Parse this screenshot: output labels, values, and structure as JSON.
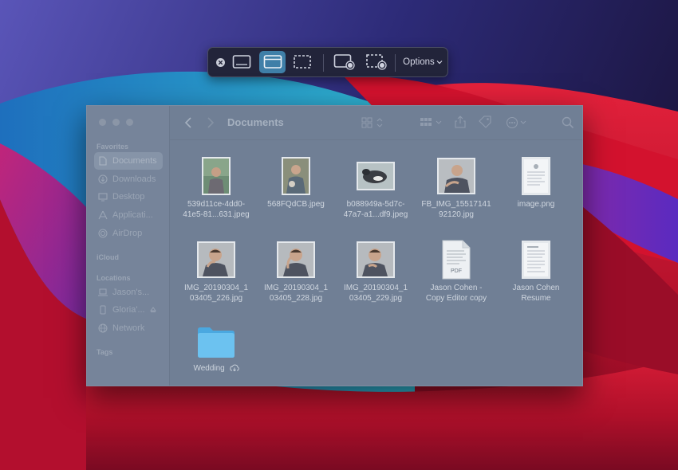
{
  "toolbar": {
    "close_icon": "close-icon",
    "modes": [
      "capture-entire-screen",
      "capture-selected-window",
      "capture-selected-portion",
      "record-entire-screen",
      "record-selected-portion"
    ],
    "options_label": "Options",
    "accent": "#3f7fa8"
  },
  "finder": {
    "title": "Documents",
    "sidebar": {
      "favorites_header": "Favorites",
      "favorites": [
        {
          "label": "Documents",
          "icon": "document-icon",
          "selected": true
        },
        {
          "label": "Downloads",
          "icon": "download-icon"
        },
        {
          "label": "Desktop",
          "icon": "desktop-icon"
        },
        {
          "label": "Applicati...",
          "icon": "applications-icon"
        },
        {
          "label": "AirDrop",
          "icon": "airdrop-icon"
        }
      ],
      "icloud_header": "iCloud",
      "locations_header": "Locations",
      "locations": [
        {
          "label": "Jason's...",
          "icon": "laptop-icon"
        },
        {
          "label": "Gloria'...",
          "icon": "phone-icon"
        },
        {
          "label": "Network",
          "icon": "network-icon"
        }
      ],
      "tags_header": "Tags"
    },
    "files": [
      {
        "line1": "539d11ce-4dd0-",
        "line2": "41e5-81...631.jpeg",
        "kind": "photo-portrait"
      },
      {
        "line1": "568FQdCB.jpeg",
        "line2": "",
        "kind": "photo-portrait"
      },
      {
        "line1": "b088949a-5d7c-",
        "line2": "47a7-a1...df9.jpeg",
        "kind": "photo-landscape"
      },
      {
        "line1": "FB_IMG_15517141",
        "line2": "92120.jpg",
        "kind": "photo-landscape"
      },
      {
        "line1": "image.png",
        "line2": "",
        "kind": "document"
      },
      {
        "line1": "IMG_20190304_1",
        "line2": "03405_226.jpg",
        "kind": "photo-landscape"
      },
      {
        "line1": "IMG_20190304_1",
        "line2": "03405_228.jpg",
        "kind": "photo-landscape"
      },
      {
        "line1": "IMG_20190304_1",
        "line2": "03405_229.jpg",
        "kind": "photo-landscape"
      },
      {
        "line1": "Jason Cohen -",
        "line2": "Copy Editor copy",
        "kind": "pdf",
        "badge": "PDF"
      },
      {
        "line1": "Jason Cohen",
        "line2": "Resume",
        "kind": "document"
      },
      {
        "line1": "Wedding",
        "line2": "",
        "kind": "folder",
        "cloud_icon": "cloud-download-icon"
      }
    ]
  }
}
